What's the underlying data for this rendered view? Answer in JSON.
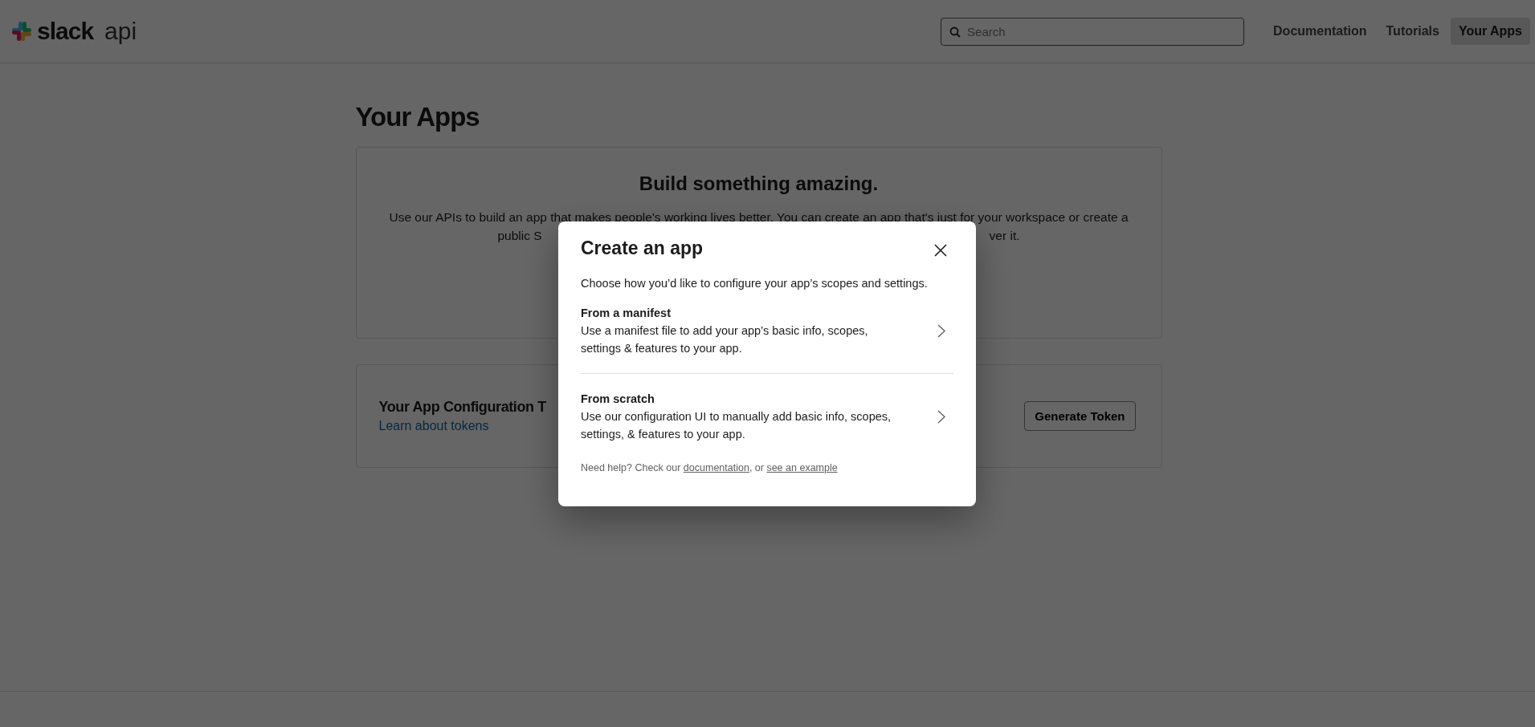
{
  "header": {
    "logo": {
      "word": "slack",
      "suffix": "api"
    },
    "search": {
      "placeholder": "Search"
    },
    "nav": [
      {
        "label": "Documentation",
        "selected": false
      },
      {
        "label": "Tutorials",
        "selected": false
      },
      {
        "label": "Your Apps",
        "selected": true
      }
    ]
  },
  "page": {
    "title": "Your Apps",
    "intro_card": {
      "heading": "Build something amazing.",
      "line_1": "Use our APIs to build an app that makes people's working lives better. You can create an app that's just for your workspace or create a",
      "line_2_start": "public S",
      "line_2_end": "ver it."
    },
    "token_card": {
      "title": "Your App Configuration T",
      "link": "Learn about tokens",
      "button": "Generate Token"
    }
  },
  "modal": {
    "title": "Create an app",
    "description": "Choose how you’d like to configure your app’s scopes and settings.",
    "options": [
      {
        "title": "From a manifest",
        "description": "Use a manifest file to add your app’s basic info, scopes, settings & features to your app."
      },
      {
        "title": "From scratch",
        "description": "Use our configuration UI to manually add basic info, scopes, settings, & features to your app."
      }
    ],
    "help": {
      "prefix": "Need help? Check our ",
      "link_1": "documentation",
      "middle": ", or ",
      "link_2": "see an example"
    }
  }
}
